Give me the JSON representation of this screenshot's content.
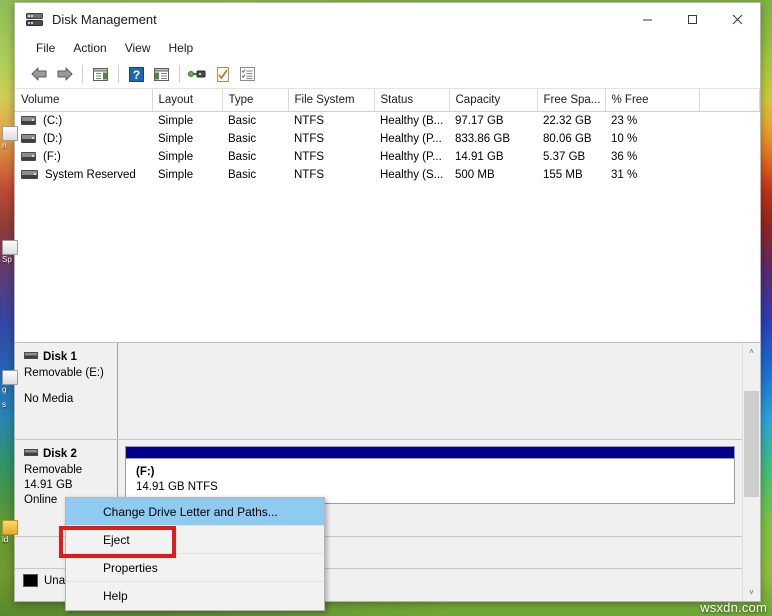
{
  "window": {
    "title": "Disk Management",
    "icon": "disk-management-icon",
    "controls": {
      "minimize": "—",
      "maximize": "☐",
      "close": "✕"
    }
  },
  "menubar": {
    "items": [
      {
        "label": "File"
      },
      {
        "label": "Action"
      },
      {
        "label": "View"
      },
      {
        "label": "Help"
      }
    ]
  },
  "toolbar": {
    "buttons": [
      {
        "name": "back-button",
        "icon": "arrow-left-icon"
      },
      {
        "name": "forward-button",
        "icon": "arrow-right-icon"
      },
      {
        "name": "show-hide-console-tree-button",
        "icon": "console-tree-icon"
      },
      {
        "name": "help-button",
        "icon": "question-mark-icon"
      },
      {
        "name": "show-hide-action-pane-button",
        "icon": "action-pane-icon"
      },
      {
        "name": "rescan-disks-button",
        "icon": "disk-probe-icon"
      },
      {
        "name": "properties-button",
        "icon": "checked-page-icon"
      },
      {
        "name": "list-view-button",
        "icon": "checklist-icon"
      }
    ]
  },
  "volume_list": {
    "columns": [
      "Volume",
      "Layout",
      "Type",
      "File System",
      "Status",
      "Capacity",
      "Free Spa...",
      "% Free",
      ""
    ],
    "rows": [
      {
        "icon": "volume-icon",
        "volume": "(C:)",
        "layout": "Simple",
        "type": "Basic",
        "file_system": "NTFS",
        "status": "Healthy (B...",
        "capacity": "97.17 GB",
        "free_space": "22.32 GB",
        "percent_free": "23 %"
      },
      {
        "icon": "volume-icon",
        "volume": "(D:)",
        "layout": "Simple",
        "type": "Basic",
        "file_system": "NTFS",
        "status": "Healthy (P...",
        "capacity": "833.86 GB",
        "free_space": "80.06 GB",
        "percent_free": "10 %"
      },
      {
        "icon": "volume-icon",
        "volume": "(F:)",
        "layout": "Simple",
        "type": "Basic",
        "file_system": "NTFS",
        "status": "Healthy (P...",
        "capacity": "14.91 GB",
        "free_space": "5.37 GB",
        "percent_free": "36 %"
      },
      {
        "icon": "volume-icon",
        "volume": "System Reserved",
        "layout": "Simple",
        "type": "Basic",
        "file_system": "NTFS",
        "status": "Healthy (S...",
        "capacity": "500 MB",
        "free_space": "155 MB",
        "percent_free": "31 %"
      }
    ]
  },
  "disks": [
    {
      "name": "Disk 1",
      "type": "Removable (E:)",
      "size": "",
      "state": "",
      "media": "No Media",
      "has_partition": false
    },
    {
      "name": "Disk 2",
      "type": "Removable",
      "size": "14.91 GB",
      "state": "Online",
      "media": "",
      "has_partition": true,
      "partition": {
        "label": "(F:)",
        "detail": "14.91 GB NTFS",
        "bar_color": "#00008b"
      }
    }
  ],
  "legend": {
    "items": [
      {
        "swatch": "#000000",
        "label": "Unallocated"
      }
    ]
  },
  "context_menu": {
    "items": [
      {
        "label": "Change Drive Letter and Paths...",
        "highlighted": true,
        "name": "ctx-change-drive-letter"
      },
      {
        "label": "Eject",
        "highlighted": false,
        "name": "ctx-eject"
      },
      {
        "label": "Properties",
        "highlighted": false,
        "name": "ctx-properties"
      },
      {
        "label": "Help",
        "highlighted": false,
        "name": "ctx-help"
      }
    ],
    "annotation_color": "#e01b1b",
    "annotated_item": "Eject"
  },
  "scrollbar": {
    "up_arrow": "˄",
    "down_arrow": "˅"
  },
  "watermark": "wsxdn.com",
  "desktop": {
    "icons": [
      {
        "label": "n"
      },
      {
        "label": "Sp"
      },
      {
        "label": "g"
      },
      {
        "label": "s"
      },
      {
        "label": "id"
      }
    ]
  }
}
